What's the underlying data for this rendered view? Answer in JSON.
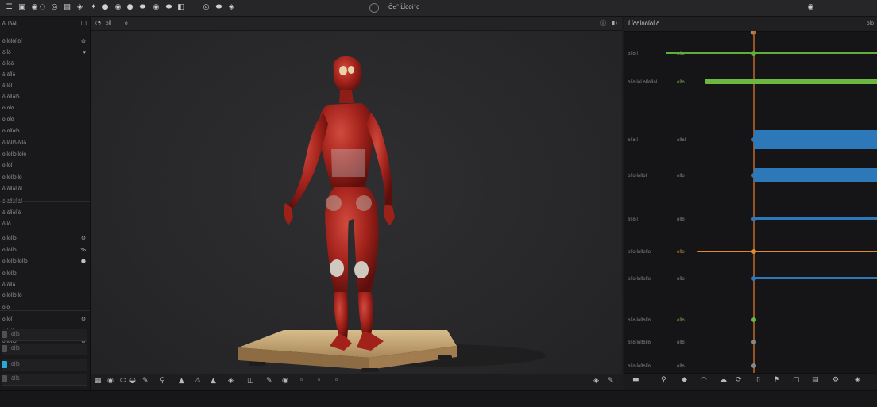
{
  "topbar": {
    "title": "Ōe˜ĺĹĺōōiˆō",
    "icons": [
      "menu-icon",
      "file-icon",
      "save-icon",
      "undo-icon",
      "redo-icon",
      "grid-icon",
      "camera-icon",
      "move-icon",
      "rotate-icon",
      "scale-icon",
      "sphere-icon",
      "light-icon",
      "render-icon",
      "play-icon",
      "link-icon",
      "settings-icon",
      "help-icon",
      "maximize-icon",
      "close-icon"
    ]
  },
  "left_panel": {
    "header": "ōĹĺōōĺ",
    "rows": [
      {
        "label": "ōĺĺōĺōĺĺōĺ",
        "indicator": "⊙"
      },
      {
        "label": "ōĺĺō",
        "indicator": "▾"
      },
      {
        "label": "ōĺĺōō",
        "indicator": ""
      },
      {
        "label": "ō ōĺĺō",
        "indicator": ""
      },
      {
        "label": "ōĺĺōĺ",
        "indicator": ""
      },
      {
        "label": "ō ōĺĺōĺō",
        "indicator": ""
      },
      {
        "label": "ō ōĺō",
        "indicator": ""
      },
      {
        "label": "ō ōĺō",
        "indicator": ""
      },
      {
        "label": "ō ōĺĺōĺō",
        "indicator": ""
      },
      {
        "label": "ōĺĺōĺĺōĺōĺĺō",
        "indicator": ""
      },
      {
        "label": "ōĺĺōĺĺōĺĺōĺō",
        "indicator": ""
      },
      {
        "label": "ōĺĺōĺ",
        "indicator": ""
      },
      {
        "label": "ōĺĺōĺĺōĺĺō",
        "indicator": ""
      },
      {
        "label": "ō ōĺĺōĺĺōĺ",
        "indicator": ""
      },
      {
        "label": "ō ōĺĺōĺĺōĺ",
        "indicator": ""
      },
      {
        "label": "ō ōĺĺōĺĺō",
        "indicator": ""
      },
      {
        "label": "ōĺĺō",
        "indicator": ""
      },
      {
        "label": "ōĺĺōĺĺō",
        "indicator": "⊙"
      },
      {
        "label": "ōĺĺōĺĺō",
        "indicator": "%"
      },
      {
        "label": "ōĺĺōĺĺōĺĺōĺĺō",
        "indicator": "●"
      },
      {
        "label": "ōĺĺōĺĺō",
        "indicator": ""
      },
      {
        "label": "ō ōĺĺō",
        "indicator": ""
      },
      {
        "label": "ōĺĺōĺĺōĺĺō",
        "indicator": ""
      },
      {
        "label": "ōĺō",
        "indicator": ""
      },
      {
        "label": "ōĺĺōĺ",
        "indicator": "⊙"
      },
      {
        "label": "ōĺĺōĺĺō",
        "indicator": "⊙"
      },
      {
        "label": "ōĺĺōĺĺō",
        "indicator": "⊙"
      },
      {
        "label": "ōĺĺōĺ",
        "indicator": ""
      }
    ],
    "slots": [
      "ōĺĺō",
      "ōĺĺō",
      "ōĺĺō",
      "ōĺĺō",
      "ōĺĺō",
      "ōĺĺō"
    ]
  },
  "viewport": {
    "header_label": "ōĺĺ",
    "header_sub": "ō",
    "footer_icons": [
      "select-icon",
      "lasso-icon",
      "brush-icon",
      "fill-icon",
      "pen-icon",
      "pin-icon",
      "sculpt-icon",
      "warning-icon",
      "triangle-icon",
      "mesh-icon",
      "paint-icon",
      "brush-tool-icon",
      "camera-icon",
      "vertex-icon",
      "edge-icon",
      "face-icon",
      "pencil-icon",
      "nav-icon"
    ]
  },
  "right_panel": {
    "header": "ĹĺōōĺōōĺōĹō",
    "header_right": "ōĺō",
    "top_marker": "4|",
    "tracks": [
      {
        "label": "ōĺĺōĺĺ",
        "sub": "ōĺĺō",
        "color": "#5fae3a",
        "type": "green-thin"
      },
      {
        "label": "ōĺĺōĺĺōĺ ōĺĺōĺĺōĺ",
        "sub": "ōĺĺō",
        "color": "#6cb73f",
        "type": "green"
      },
      {
        "label": "ōĺĺōĺĺ",
        "sub": "ōĺĺōĺ",
        "color": "#2c78b8",
        "type": "blue"
      },
      {
        "label": "ōĺĺōĺĺōĺĺōĺ",
        "sub": "ōĺĺō",
        "color": "#2c78b8",
        "type": "blue"
      },
      {
        "label": "ōĺĺōĺĺ",
        "sub": "ōĺĺō",
        "color": "#2c78b8",
        "type": "blue-thin"
      },
      {
        "label": "ōĺĺōĺĺōĺĺōĺĺō",
        "sub": "ōĺĺō",
        "color": "#e08a30",
        "type": "orange"
      },
      {
        "label": "ōĺĺōĺĺōĺĺōĺĺō",
        "sub": "ōĺĺō",
        "color": "#2c78b8",
        "type": "blue-thin"
      },
      {
        "label": "ōĺĺōĺĺōĺĺōĺĺō",
        "sub": "ōĺĺō",
        "color": "#6cb73f",
        "type": "green-dot"
      },
      {
        "label": "ōĺĺōĺĺōĺĺōĺĺō",
        "sub": "ōĺĺō",
        "color": "#888",
        "type": "plain"
      },
      {
        "label": "ōĺĺōĺĺōĺĺōĺĺō",
        "sub": "ōĺĺō",
        "color": "#888",
        "type": "plain"
      }
    ],
    "footer_icons": [
      "minus-icon",
      "zoom-icon",
      "key-icon",
      "curve-icon",
      "cloud-icon",
      "loop-icon",
      "clip-icon",
      "bookmark-icon",
      "copy-icon",
      "layers-icon",
      "settings-icon",
      "mesh-icon"
    ]
  },
  "colors": {
    "accent_green": "#6cb73f",
    "accent_blue": "#2c78b8",
    "accent_orange": "#e08a30",
    "figure_red": "#a2221b",
    "pedestal": "#c8a878"
  }
}
